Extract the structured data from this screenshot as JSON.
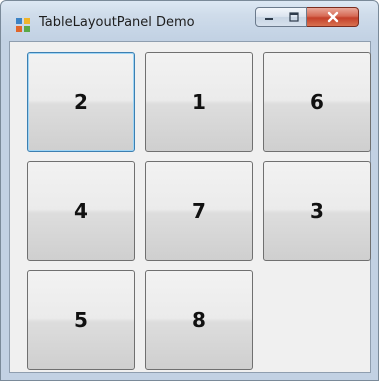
{
  "window": {
    "title": "TableLayoutPanel Demo"
  },
  "caption_buttons": {
    "minimize": "minimize-icon",
    "maximize": "maximize-icon",
    "close": "close-icon"
  },
  "tiles": [
    {
      "label": "2",
      "focused": true
    },
    {
      "label": "1",
      "focused": false
    },
    {
      "label": "6",
      "focused": false
    },
    {
      "label": "4",
      "focused": false
    },
    {
      "label": "7",
      "focused": false
    },
    {
      "label": "3",
      "focused": false
    },
    {
      "label": "5",
      "focused": false
    },
    {
      "label": "8",
      "focused": false
    }
  ],
  "colors": {
    "focus_border": "#3c7fb1",
    "close_button": "#c4402a"
  }
}
